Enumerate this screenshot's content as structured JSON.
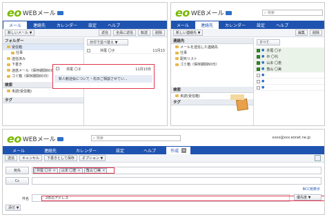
{
  "brand": {
    "eo": "eo",
    "name": "WEBメール"
  },
  "panel1": {
    "tabs": [
      "メール",
      "連絡先",
      "カレンダー",
      "設定",
      "ヘルプ"
    ],
    "new_button": "新しいメール ▼",
    "toolbar": [
      "返信",
      "全員に返信",
      "転送",
      "削除"
    ],
    "filter": "日付で並べ替え ▼",
    "folder_header": "フォルダー",
    "folders": [
      "受信箱",
      "仕事",
      "送信済み",
      "下書き",
      "迷惑メール（保存期間60日）",
      "ゴミ箱（保存期間60日）"
    ],
    "search_header": "検索",
    "search_item": "未読(受信箱)",
    "tag_header": "タグ",
    "msg_sender": "井尾 〇子",
    "msg_date": "11月13",
    "drag_sender": "井尾 〇子",
    "drag_date": "11月13日",
    "drag_subject": "新人歓迎会について・先日ご相談させてい..."
  },
  "panel2": {
    "search_placeholder": "検索",
    "tabs": [
      "メール",
      "連絡先",
      "カレンダー",
      "設定",
      "ヘルプ"
    ],
    "new_button": "新しい連絡先 ▼",
    "toolbar": [
      "編集",
      "削除"
    ],
    "contacts_header": "連絡先",
    "groups": [
      "メールを送信した連絡先",
      "仕事",
      "配布リスト",
      "ゴミ箱（保存期間60日）"
    ],
    "search_header": "検索",
    "search_item": "未読(受信箱)",
    "tag_header": "タグ",
    "filter": "すべて",
    "contacts": [
      "井尾 〇子",
      "中 〇代",
      "山本 〇恵",
      "角山 〇美",
      "",
      "",
      ""
    ]
  },
  "panel3": {
    "account": "xxxx@xxx.eonet.ne.jp",
    "search_placeholder": "検索",
    "tabs": [
      "メール",
      "連絡先",
      "カレンダー",
      "設定",
      "ヘルプ",
      "作成"
    ],
    "toolbar": [
      "送信",
      "キャンセル",
      "下書きとして保存",
      "オプション ▼"
    ],
    "to_label": "宛先",
    "to_chips": [
      "井尾 〇子",
      "山本 〇恵",
      "角山 〇美"
    ],
    "cc_label": "Cc",
    "bcc_link": "BCC宛表示",
    "subject_label": "件名",
    "subject_value": "2件のアドレス",
    "priority": "優先度 ▼",
    "attach_button": "添付 ▼"
  },
  "colors": {
    "nav": "#1f53b0",
    "eo_green": "#78b800",
    "highlight": "#e0324b"
  }
}
